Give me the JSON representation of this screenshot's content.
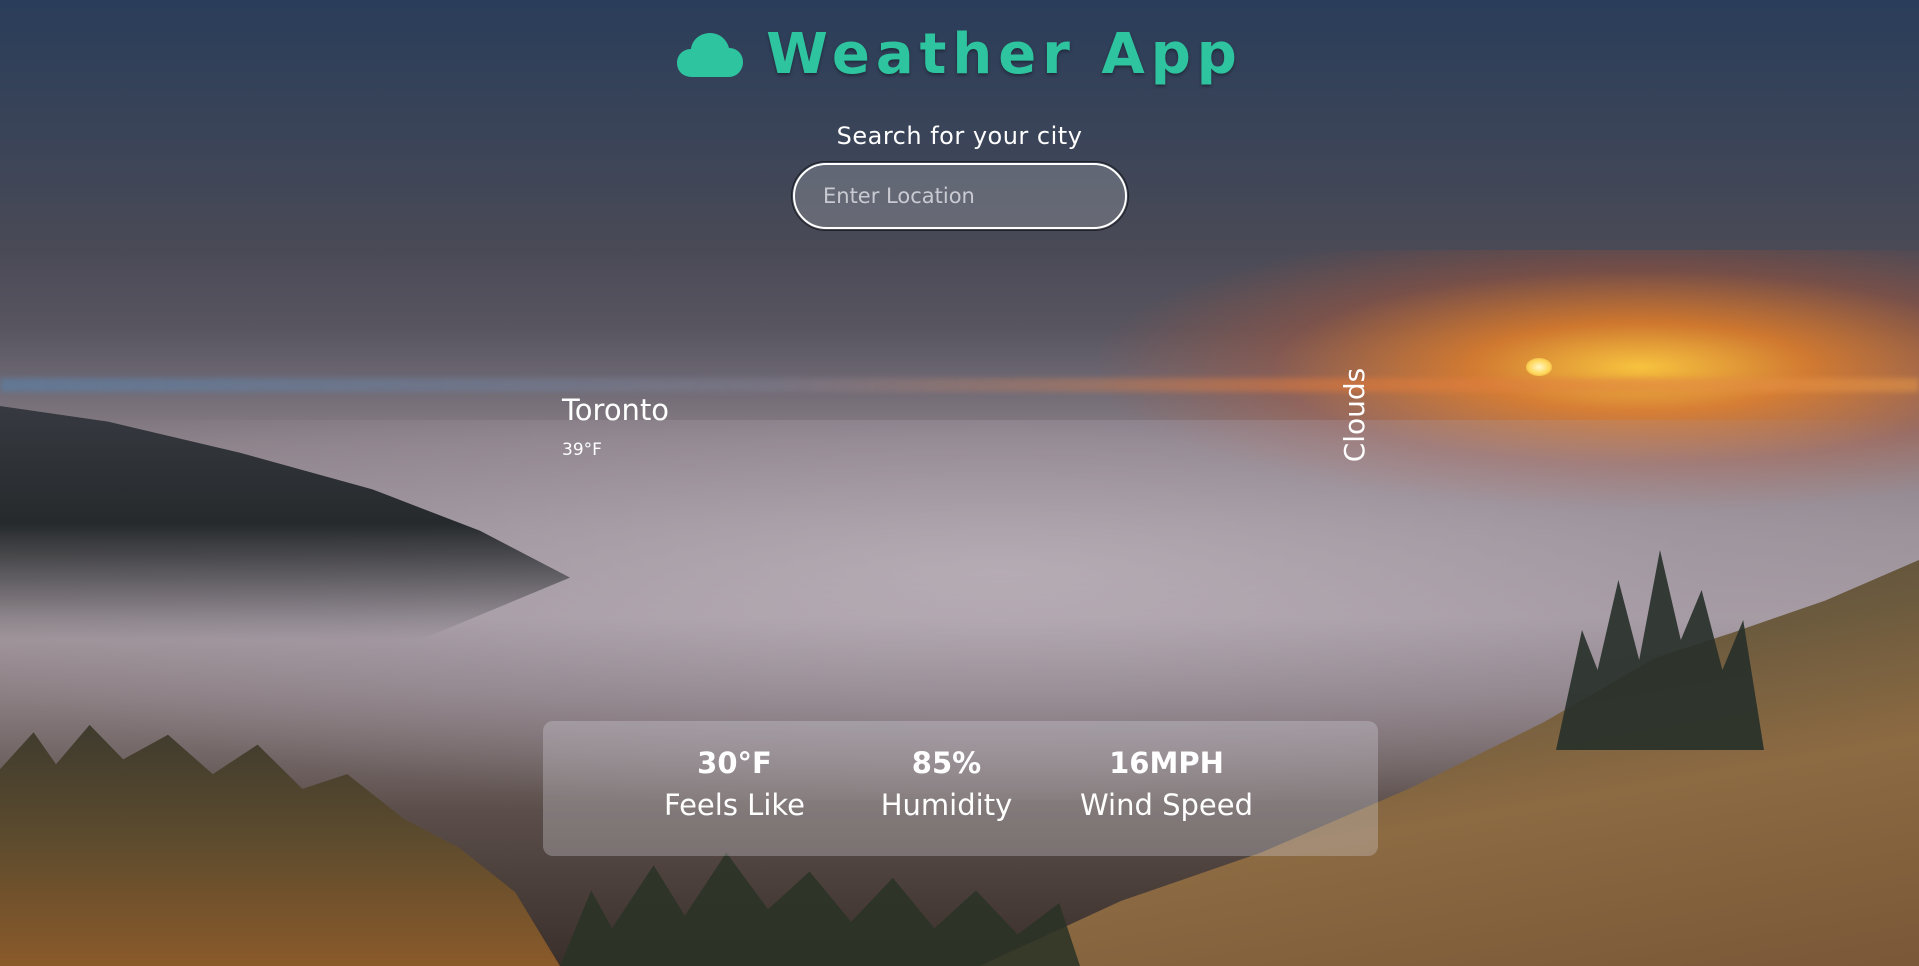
{
  "app": {
    "title": "Weather App",
    "icon": "cloud-icon",
    "accent_color": "#2ec4a0"
  },
  "search": {
    "label": "Search for your city",
    "placeholder": "Enter Location",
    "value": ""
  },
  "current": {
    "city": "Toronto",
    "temperature": "39°F",
    "condition": "Clouds"
  },
  "stats": {
    "feels_like": {
      "value": "30°F",
      "label": "Feels Like"
    },
    "humidity": {
      "value": "85%",
      "label": "Humidity"
    },
    "wind_speed": {
      "value": "16MPH",
      "label": "Wind Speed"
    }
  }
}
